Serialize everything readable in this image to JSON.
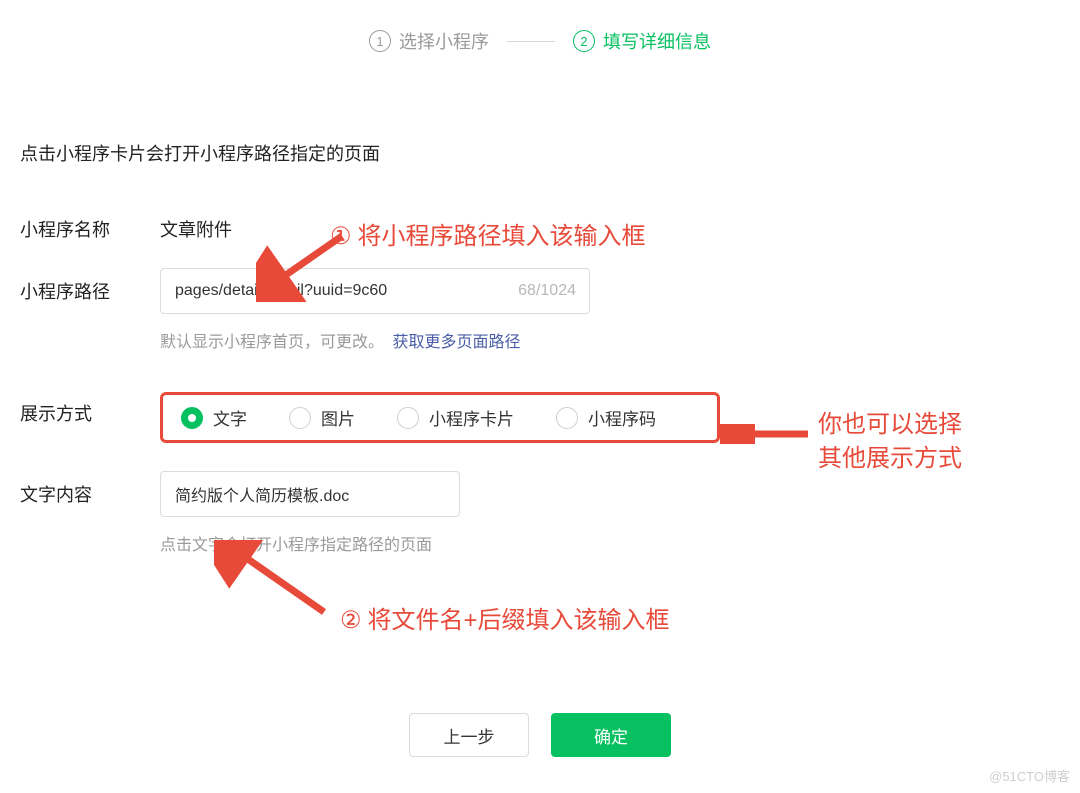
{
  "stepper": {
    "step1": {
      "num": "1",
      "label": "选择小程序"
    },
    "step2": {
      "num": "2",
      "label": "填写详细信息"
    }
  },
  "intro": "点击小程序卡片会打开小程序路径指定的页面",
  "form": {
    "name": {
      "label": "小程序名称",
      "value": "文章附件"
    },
    "path": {
      "label": "小程序路径",
      "value": "pages/detail/detail?uuid=9c60",
      "counter": "68/1024",
      "hint_text": "默认显示小程序首页，可更改。",
      "hint_link": "获取更多页面路径"
    },
    "display": {
      "label": "展示方式",
      "options": [
        "文字",
        "图片",
        "小程序卡片",
        "小程序码"
      ],
      "selected": "文字"
    },
    "text_content": {
      "label": "文字内容",
      "value": "简约版个人简历模板.doc",
      "hint": "点击文字会打开小程序指定路径的页面"
    }
  },
  "annotations": {
    "a1": "将小程序路径填入该输入框",
    "a1_num": "①",
    "a2": "将文件名+后缀填入该输入框",
    "a2_num": "②",
    "a3_line1": "你也可以选择",
    "a3_line2": "其他展示方式"
  },
  "footer": {
    "prev": "上一步",
    "confirm": "确定"
  },
  "watermark": "@51CTO博客",
  "colors": {
    "accent": "#07c160",
    "annotation": "#e84a3a"
  }
}
